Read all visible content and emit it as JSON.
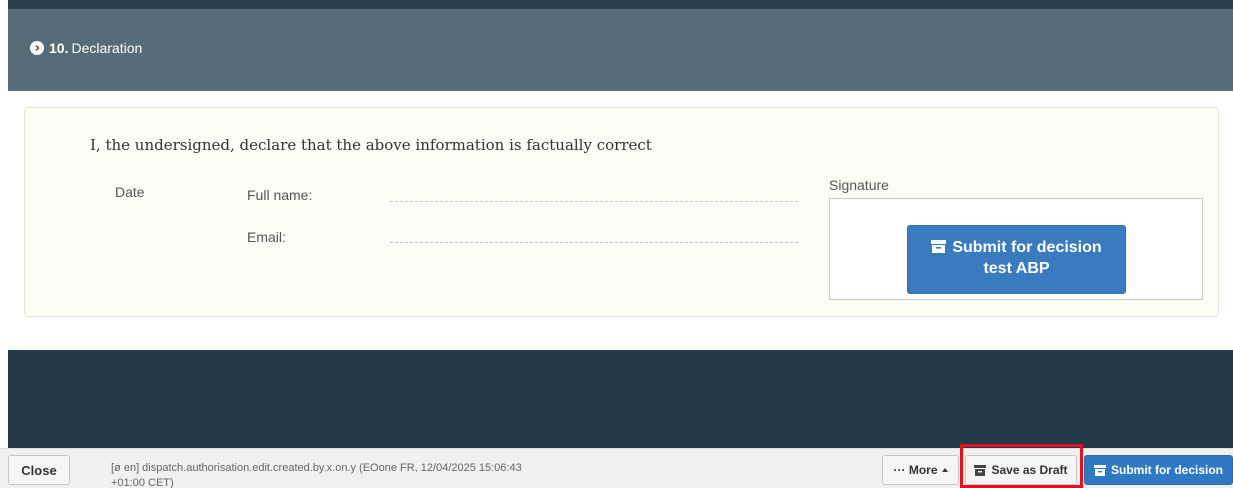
{
  "section": {
    "number": "10.",
    "title": "Declaration"
  },
  "declaration": {
    "statement": "I, the undersigned, declare that the above information is factually correct",
    "date_label": "Date",
    "full_name_label": "Full name:",
    "full_name_value": "",
    "email_label": "Email:",
    "email_value": "",
    "signature_label": "Signature",
    "submit_line1": "Submit for decision",
    "submit_line2": "test ABP"
  },
  "footer": {
    "close_label": "Close",
    "meta_text": "[ø en] dispatch.authorisation.edit.created.by.x.on.y (EOone FR, 12/04/2025 15:06:43 +01:00 CET)",
    "more_label": "··· More",
    "save_draft_label": "Save as Draft",
    "submit_label": "Submit for decision"
  },
  "colors": {
    "header": "#586b79",
    "dark_band": "#243a48",
    "primary": "#2f79c3",
    "highlight": "#e8101b"
  }
}
